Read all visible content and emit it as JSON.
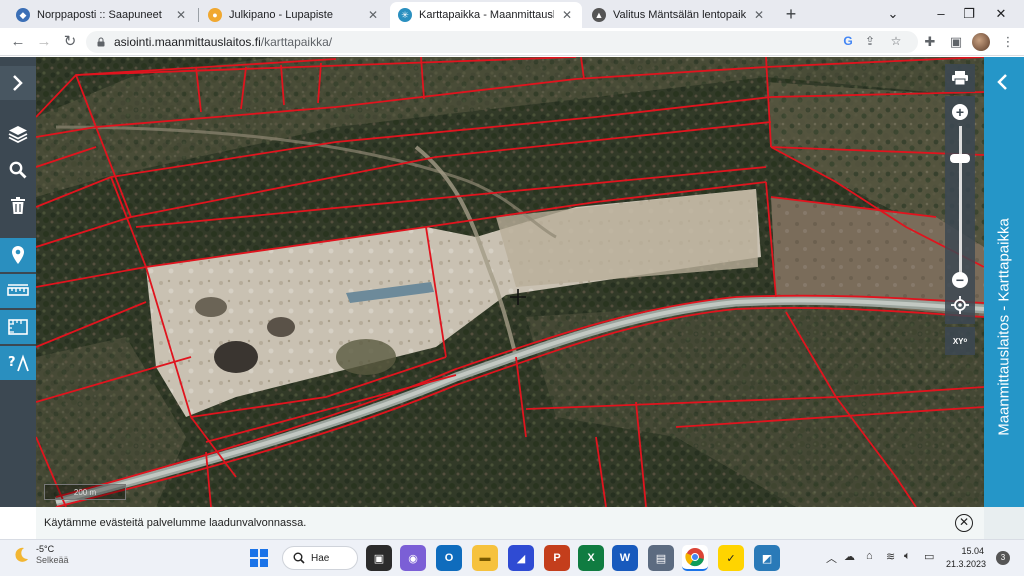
{
  "tabs": [
    {
      "title": "Norppaposti :: Saapuneet",
      "color": "#3b6fb6"
    },
    {
      "title": "Julkipano - Lupapiste",
      "color": "#f0a830"
    },
    {
      "title": "Karttapaikka - Maanmittauslaitos",
      "color": "#2a8fbf"
    },
    {
      "title": "Valitus Mäntsälän lentopaikkaa. K",
      "color": "#555555"
    }
  ],
  "window": {
    "minimize": "–",
    "restore": "❐",
    "close": "✕",
    "newtab": "+"
  },
  "address": {
    "host": "asiointi.maanmittauslaitos.fi",
    "path": "/karttapaikka/"
  },
  "map": {
    "scale_label": "200 m",
    "side_panel_title": "Maanmittauslaitos - Karttapaikka",
    "coords_button": "XY",
    "parcel_line_color": "#e0141e"
  },
  "cookie": {
    "text": "Käytämme evästeitä palvelumme laadunvalvonnassa."
  },
  "taskbar": {
    "weather_temp": "-5°C",
    "weather_desc": "Selkeää",
    "search_label": "Hae",
    "time": "15.04",
    "date": "21.3.2023",
    "notifications": "3"
  }
}
